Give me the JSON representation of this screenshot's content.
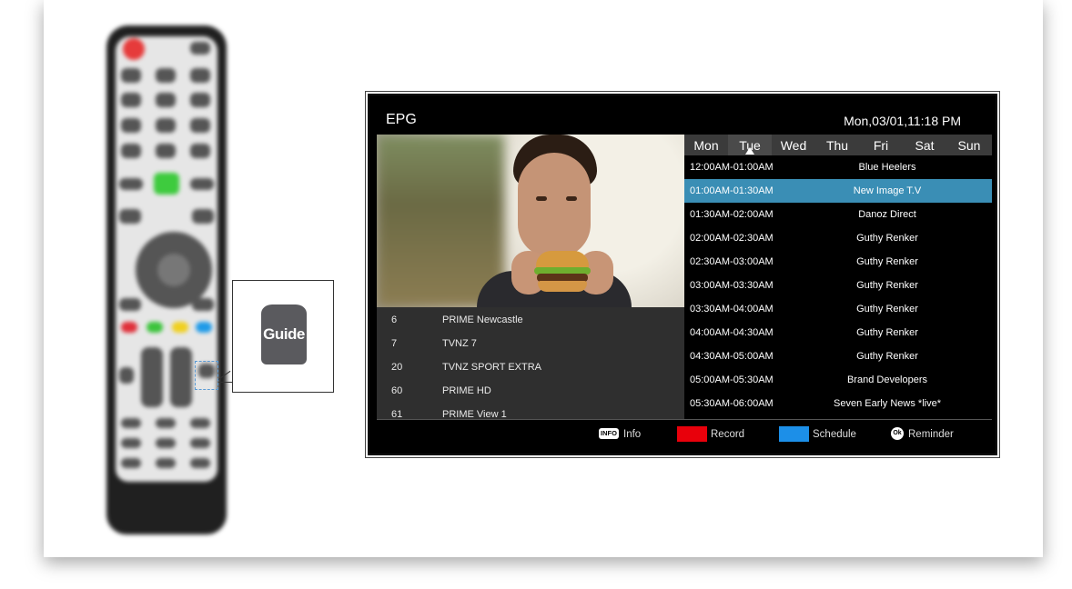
{
  "callout": {
    "key_label": "Guide"
  },
  "epg": {
    "title": "EPG",
    "datetime": "Mon,03/01,11:18 PM",
    "days": [
      "Mon",
      "Tue",
      "Wed",
      "Thu",
      "Fri",
      "Sat",
      "Sun"
    ],
    "selected_day": "Tue",
    "channels": [
      {
        "number": "6",
        "name": "PRIME Newcastle"
      },
      {
        "number": "7",
        "name": "TVNZ 7"
      },
      {
        "number": "20",
        "name": "TVNZ SPORT EXTRA"
      },
      {
        "number": "60",
        "name": "PRIME HD"
      },
      {
        "number": "61",
        "name": "PRIME View 1"
      }
    ],
    "programs": [
      {
        "time": "12:00AM-01:00AM",
        "title": "Blue Heelers"
      },
      {
        "time": "01:00AM-01:30AM",
        "title": "New Image T.V"
      },
      {
        "time": "01:30AM-02:00AM",
        "title": "Danoz Direct"
      },
      {
        "time": "02:00AM-02:30AM",
        "title": "Guthy Renker"
      },
      {
        "time": "02:30AM-03:00AM",
        "title": "Guthy Renker"
      },
      {
        "time": "03:00AM-03:30AM",
        "title": "Guthy Renker"
      },
      {
        "time": "03:30AM-04:00AM",
        "title": "Guthy Renker"
      },
      {
        "time": "04:00AM-04:30AM",
        "title": "Guthy Renker"
      },
      {
        "time": "04:30AM-05:00AM",
        "title": "Guthy Renker"
      },
      {
        "time": "05:00AM-05:30AM",
        "title": "Brand Developers"
      },
      {
        "time": "05:30AM-06:00AM",
        "title": "Seven Early News *live*"
      }
    ],
    "selected_program": "New Image T.V",
    "footer": {
      "info_badge": "INFO",
      "info": "Info",
      "record": "Record",
      "schedule": "Schedule",
      "ok_badge": "Ok",
      "reminder": "Reminder"
    },
    "colors": {
      "record": "#e8000b",
      "schedule": "#1c8fe8",
      "highlight": "#3a8eb5"
    }
  }
}
